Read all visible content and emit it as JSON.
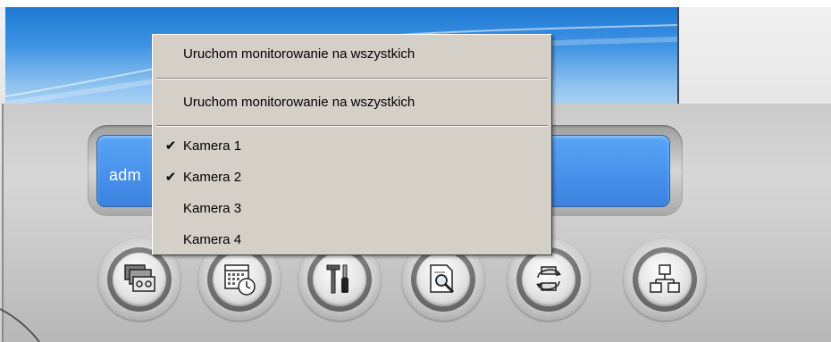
{
  "display": {
    "visible_text": "adm"
  },
  "context_menu": {
    "items": [
      {
        "label": "Uruchom monitorowanie na wszystkich",
        "checked": false
      },
      {
        "label": "Uruchom monitorowanie na wszystkich",
        "checked": false
      }
    ],
    "cameras": [
      {
        "label": "Kamera 1",
        "checked": true,
        "check_mark": "✔"
      },
      {
        "label": "Kamera 2",
        "checked": true,
        "check_mark": "✔"
      },
      {
        "label": "Kamera 3",
        "checked": false,
        "check_mark": ""
      },
      {
        "label": "Kamera 4",
        "checked": false,
        "check_mark": ""
      }
    ]
  },
  "toolbar": {
    "buttons": [
      {
        "name": "video-tape-icon"
      },
      {
        "name": "calendar-clock-icon"
      },
      {
        "name": "tools-icon"
      },
      {
        "name": "document-search-icon"
      },
      {
        "name": "device-refresh-icon"
      },
      {
        "name": "network-icon"
      }
    ]
  },
  "colors": {
    "menu_bg": "#d4d0c8",
    "display_blue": "#4a93ec",
    "housing_gray": "#cfcfcf"
  }
}
